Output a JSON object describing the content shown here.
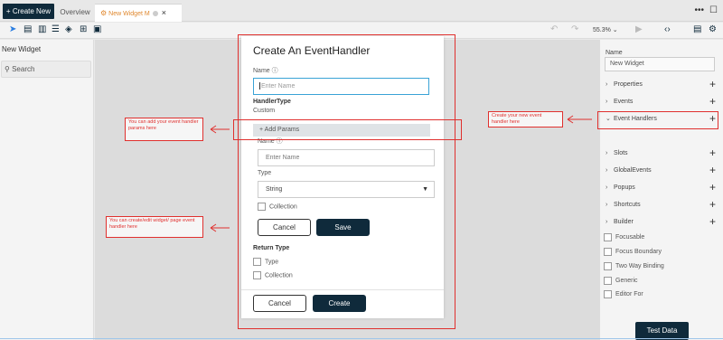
{
  "tabbar": {
    "create_new": "+ Create New",
    "overview": "Overview",
    "active_tab": "New Widget M",
    "close": "×",
    "more": "•••",
    "window": "☐"
  },
  "toolbar": {
    "zoom": "55.3% ⌄"
  },
  "left_panel": {
    "title": "New Widget",
    "search_placeholder": "Search"
  },
  "dialog": {
    "title": "Create An EventHandler",
    "name_label": "Name ⓘ",
    "name_placeholder": "Enter Name",
    "handler_type_label": "HandlerType",
    "handler_type_value": "Custom",
    "add_params": "+  Add Params",
    "param_name_label": "Name ⓘ",
    "param_name_placeholder": "Enter Name",
    "type_label": "Type",
    "type_value": "String",
    "collection_label": "Collection",
    "param_cancel": "Cancel",
    "param_save": "Save",
    "return_type_label": "Return Type",
    "return_type_check": "Type",
    "return_collection_check": "Collection",
    "cancel": "Cancel",
    "create": "Create"
  },
  "right_panel": {
    "name_label": "Name",
    "name_value": "New Widget",
    "sections": [
      {
        "label": "Properties",
        "expanded": false
      },
      {
        "label": "Events",
        "expanded": false
      },
      {
        "label": "Event Handlers",
        "expanded": true
      },
      {
        "label": "Slots",
        "expanded": false
      },
      {
        "label": "GlobalEvents",
        "expanded": false
      },
      {
        "label": "Popups",
        "expanded": false
      },
      {
        "label": "Shortcuts",
        "expanded": false
      },
      {
        "label": "Builder",
        "expanded": false
      }
    ],
    "checkboxes": [
      "Focusable",
      "Focus Boundary",
      "Two Way Binding",
      "Generic",
      "Editor For"
    ],
    "test_data": "Test Data"
  },
  "annotations": {
    "params_note": "You can add your event handler params here",
    "page_handler_note": "You can create/edit widget/ page event handler here",
    "create_note": "Create your new event handler here"
  },
  "colors": {
    "accent_dark": "#0f2a3b",
    "annotation_red": "#e0302e",
    "tab_orange": "#e0882e"
  }
}
